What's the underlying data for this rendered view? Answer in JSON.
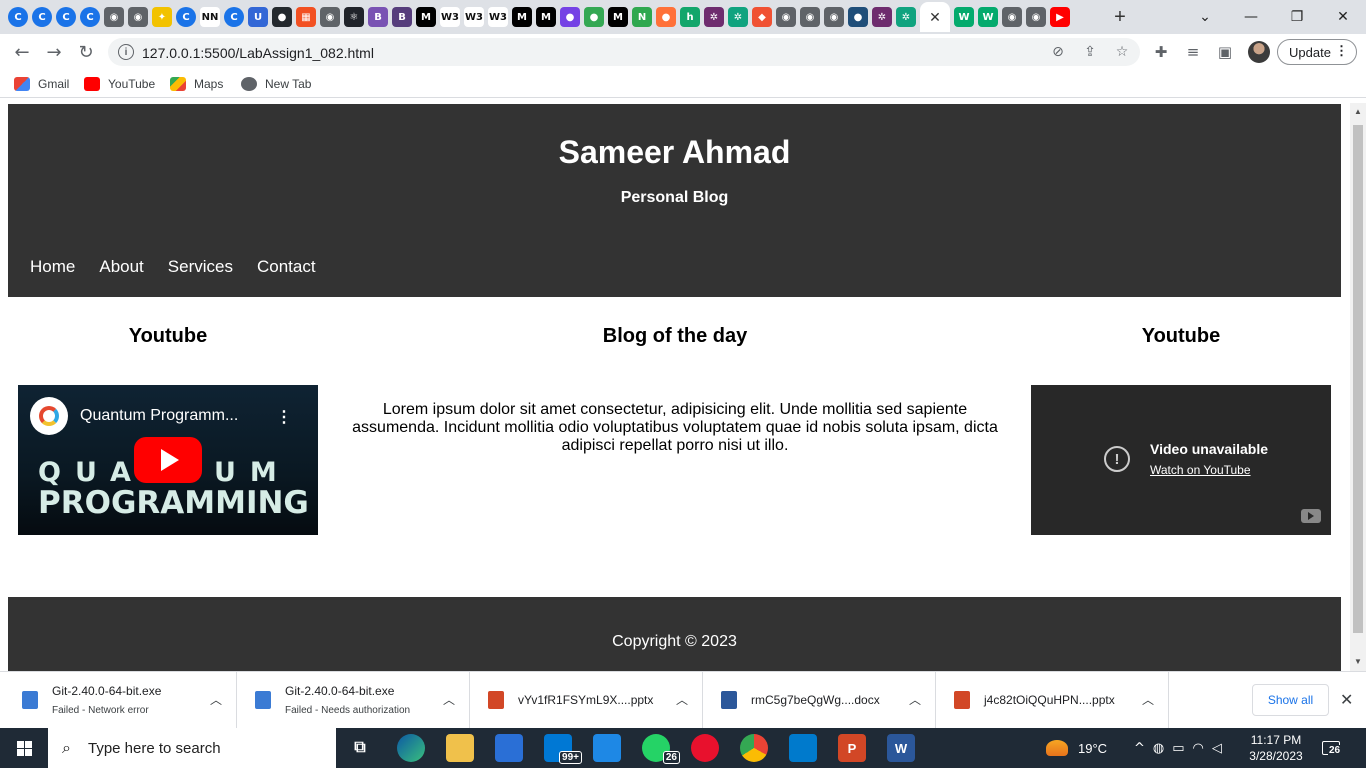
{
  "browser": {
    "tabs": [
      {
        "icon": "google-icon",
        "color": "#1a73e8",
        "glyph": "C"
      },
      {
        "icon": "google-icon",
        "color": "#1a73e8",
        "glyph": "C"
      },
      {
        "icon": "google-icon",
        "color": "#1a73e8",
        "glyph": "C"
      },
      {
        "icon": "google-icon",
        "color": "#1a73e8",
        "glyph": "C"
      },
      {
        "icon": "globe-icon",
        "color": "#5f6368",
        "glyph": "◉"
      },
      {
        "icon": "globe-icon",
        "color": "#5f6368",
        "glyph": "◉"
      },
      {
        "icon": "bulb-icon",
        "color": "#f2c200",
        "glyph": "✦"
      },
      {
        "icon": "google-icon",
        "color": "#1a73e8",
        "glyph": "C"
      },
      {
        "icon": "nn-icon",
        "color": "#ffffff",
        "glyph": "NN"
      },
      {
        "icon": "google-icon",
        "color": "#1a73e8",
        "glyph": "C"
      },
      {
        "icon": "u-icon",
        "color": "#3367d6",
        "glyph": "U"
      },
      {
        "icon": "github-icon",
        "color": "#24292e",
        "glyph": "●"
      },
      {
        "icon": "microsoft-icon",
        "color": "#f25022",
        "glyph": "▦"
      },
      {
        "icon": "globe-icon",
        "color": "#5f6368",
        "glyph": "◉"
      },
      {
        "icon": "react-icon",
        "color": "#20232a",
        "glyph": "⚛"
      },
      {
        "icon": "bootstrap-icon",
        "color": "#7952b3",
        "glyph": "B"
      },
      {
        "icon": "bootstrap-icon",
        "color": "#563d7c",
        "glyph": "B"
      },
      {
        "icon": "medium-icon",
        "color": "#000000",
        "glyph": "M"
      },
      {
        "icon": "w3schools-icon",
        "color": "#ffffff",
        "glyph": "W3"
      },
      {
        "icon": "w3schools-icon",
        "color": "#ffffff",
        "glyph": "W3"
      },
      {
        "icon": "w3schools-icon",
        "color": "#ffffff",
        "glyph": "W3"
      },
      {
        "icon": "medium-icon",
        "color": "#000000",
        "glyph": "M"
      },
      {
        "icon": "medium-icon",
        "color": "#000000",
        "glyph": "M"
      },
      {
        "icon": "firefox-icon",
        "color": "#7542e5",
        "glyph": "●"
      },
      {
        "icon": "chrome-icon",
        "color": "#34a853",
        "glyph": "●"
      },
      {
        "icon": "medium-icon",
        "color": "#000000",
        "glyph": "M"
      },
      {
        "icon": "n-icon",
        "color": "#2fa84f",
        "glyph": "N"
      },
      {
        "icon": "firefox-icon",
        "color": "#ff7139",
        "glyph": "●"
      },
      {
        "icon": "h-icon",
        "color": "#12a66b",
        "glyph": "h"
      },
      {
        "icon": "openai-icon",
        "color": "#6e2c6e",
        "glyph": "✲"
      },
      {
        "icon": "openai-icon",
        "color": "#10a37f",
        "glyph": "✲"
      },
      {
        "icon": "git-icon",
        "color": "#f05133",
        "glyph": "◆"
      },
      {
        "icon": "globe-icon",
        "color": "#5f6368",
        "glyph": "◉"
      },
      {
        "icon": "globe-icon",
        "color": "#5f6368",
        "glyph": "◉"
      },
      {
        "icon": "globe-icon",
        "color": "#5f6368",
        "glyph": "◉"
      },
      {
        "icon": "avatar-icon",
        "color": "#1f4e79",
        "glyph": "●"
      },
      {
        "icon": "openai-icon",
        "color": "#6e2c6e",
        "glyph": "✲"
      },
      {
        "icon": "openai-icon",
        "color": "#10a37f",
        "glyph": "✲"
      }
    ],
    "active_tab_close": "✕",
    "tabs_after": [
      {
        "icon": "w3-icon",
        "color": "#04aa6d",
        "glyph": "W"
      },
      {
        "icon": "w3-icon",
        "color": "#04aa6d",
        "glyph": "W"
      },
      {
        "icon": "globe-icon",
        "color": "#5f6368",
        "glyph": "◉"
      },
      {
        "icon": "globe-icon",
        "color": "#5f6368",
        "glyph": "◉"
      },
      {
        "icon": "youtube-icon",
        "color": "#ff0000",
        "glyph": "▶"
      }
    ],
    "new_tab": "+",
    "url": "127.0.0.1:5500/LabAssign1_082.html",
    "update_label": "Update",
    "bookmarks": [
      {
        "label": "Gmail",
        "icon": "gmail-icon",
        "color": "#ea4335"
      },
      {
        "label": "YouTube",
        "icon": "youtube-icon",
        "color": "#ff0000"
      },
      {
        "label": "Maps",
        "icon": "maps-icon",
        "color": "#34a853"
      },
      {
        "label": "New Tab",
        "icon": "globe-icon",
        "color": "#5f6368"
      }
    ]
  },
  "site": {
    "title": "Sameer Ahmad",
    "subtitle": "Personal Blog",
    "nav": [
      "Home",
      "About",
      "Services",
      "Contact"
    ],
    "left_title": "Youtube",
    "center_title": "Blog of the day",
    "right_title": "Youtube",
    "blog_text": "Lorem ipsum dolor sit amet consectetur, adipisicing elit. Unde mollitia sed sapiente assumenda. Incidunt mollitia odio voluptatibus voluptatem quae id nobis soluta ipsam, dicta adipisci repellat porro nisi ut illo.",
    "video_left": {
      "title": "Quantum Programm...",
      "line1": "QUANTUM",
      "line2": "PROGRAMMING"
    },
    "video_right": {
      "message": "Video unavailable",
      "link": "Watch on YouTube"
    },
    "footer": "Copyright © 2023"
  },
  "downloads": [
    {
      "name": "Git-2.40.0-64-bit.exe",
      "status": "Failed - Network error",
      "icon": "exe-icon",
      "color": "#3b7bd4"
    },
    {
      "name": "Git-2.40.0-64-bit.exe",
      "status": "Failed - Needs authorization",
      "icon": "exe-icon",
      "color": "#3b7bd4"
    },
    {
      "name": "vYv1fR1FSYmL9X....pptx",
      "status": "",
      "icon": "powerpoint-icon",
      "color": "#d24726"
    },
    {
      "name": "rmC5g7beQgWg....docx",
      "status": "",
      "icon": "word-icon",
      "color": "#2b579a"
    },
    {
      "name": "j4c82tOiQQuHPN....pptx",
      "status": "",
      "icon": "powerpoint-icon",
      "color": "#d24726"
    }
  ],
  "downloads_show_all": "Show all",
  "taskbar": {
    "search_placeholder": "Type here to search",
    "mail_badge": "99+",
    "whatsapp_badge": "26",
    "temperature": "19°C",
    "time": "11:17 PM",
    "date": "3/28/2023",
    "notifications": "26"
  }
}
